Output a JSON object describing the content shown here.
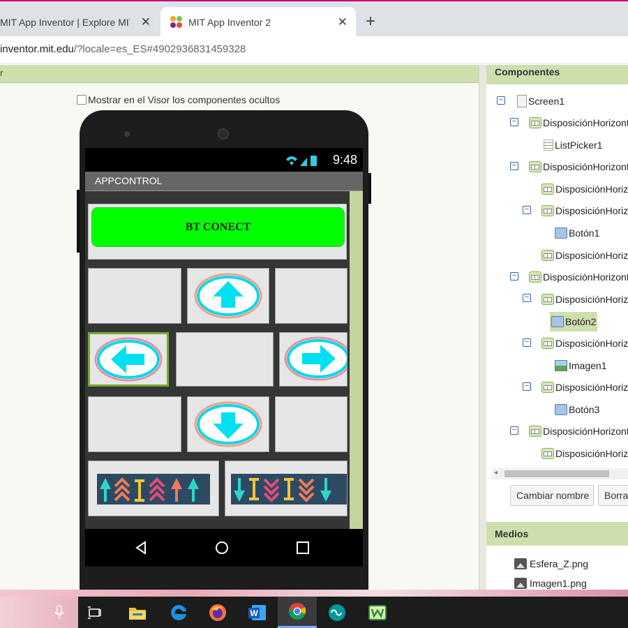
{
  "browser": {
    "tabs": [
      {
        "title": "MIT App Inventor | Explore MIT A"
      },
      {
        "title": "MIT App Inventor 2"
      }
    ],
    "url_host": "inventor.mit.edu",
    "url_rest": "/?locale=es_ES#4902936831459328"
  },
  "viewer": {
    "header_label": "r",
    "show_hidden_label": "Mostrar en el Visor los componentes ocultos",
    "phone": {
      "clock": "9:48",
      "app_title": "APPCONTROL",
      "connect_button": "BT CONECT"
    }
  },
  "components": {
    "header": "Componentes",
    "tree": [
      {
        "label": "Screen1",
        "icon": "screen-icon"
      },
      {
        "label": "DisposiciónHorizontal",
        "icon": "horizontal-arrangement-icon"
      },
      {
        "label": "ListPicker1",
        "icon": "listpicker-icon"
      },
      {
        "label": "DisposiciónHorizontal",
        "icon": "horizontal-arrangement-icon"
      },
      {
        "label": "DisposiciónHorizontal",
        "icon": "horizontal-arrangement-icon"
      },
      {
        "label": "DisposiciónHorizontal",
        "icon": "horizontal-arrangement-icon"
      },
      {
        "label": "Botón1",
        "icon": "button-icon"
      },
      {
        "label": "DisposiciónHorizontal",
        "icon": "horizontal-arrangement-icon"
      },
      {
        "label": "DisposiciónHorizontal",
        "icon": "horizontal-arrangement-icon"
      },
      {
        "label": "DisposiciónHorizontal",
        "icon": "horizontal-arrangement-icon"
      },
      {
        "label": "Botón2",
        "icon": "button-icon",
        "selected": true
      },
      {
        "label": "DisposiciónHorizontal",
        "icon": "horizontal-arrangement-icon"
      },
      {
        "label": "Imagen1",
        "icon": "image-icon"
      },
      {
        "label": "DisposiciónHorizontal",
        "icon": "horizontal-arrangement-icon"
      },
      {
        "label": "Botón3",
        "icon": "button-icon"
      },
      {
        "label": "DisposiciónHorizontal",
        "icon": "horizontal-arrangement-icon"
      },
      {
        "label": "DisposiciónHorizontal",
        "icon": "horizontal-arrangement-icon"
      }
    ],
    "rename_button": "Cambiar nombre",
    "delete_button": "Borrar"
  },
  "media": {
    "header": "Medios",
    "files": [
      "Esfera_Z.png",
      "Imagen1.png"
    ]
  },
  "colors": {
    "panel_header": "#cddfac",
    "connect_button": "#00ff00",
    "arrow_button_fill": "#00e0f0"
  },
  "taskbar_icons": [
    "microphone-icon",
    "task-view-icon",
    "file-explorer-icon",
    "edge-icon",
    "firefox-icon",
    "word-icon",
    "chrome-icon",
    "arduino-icon",
    "app-icon"
  ]
}
